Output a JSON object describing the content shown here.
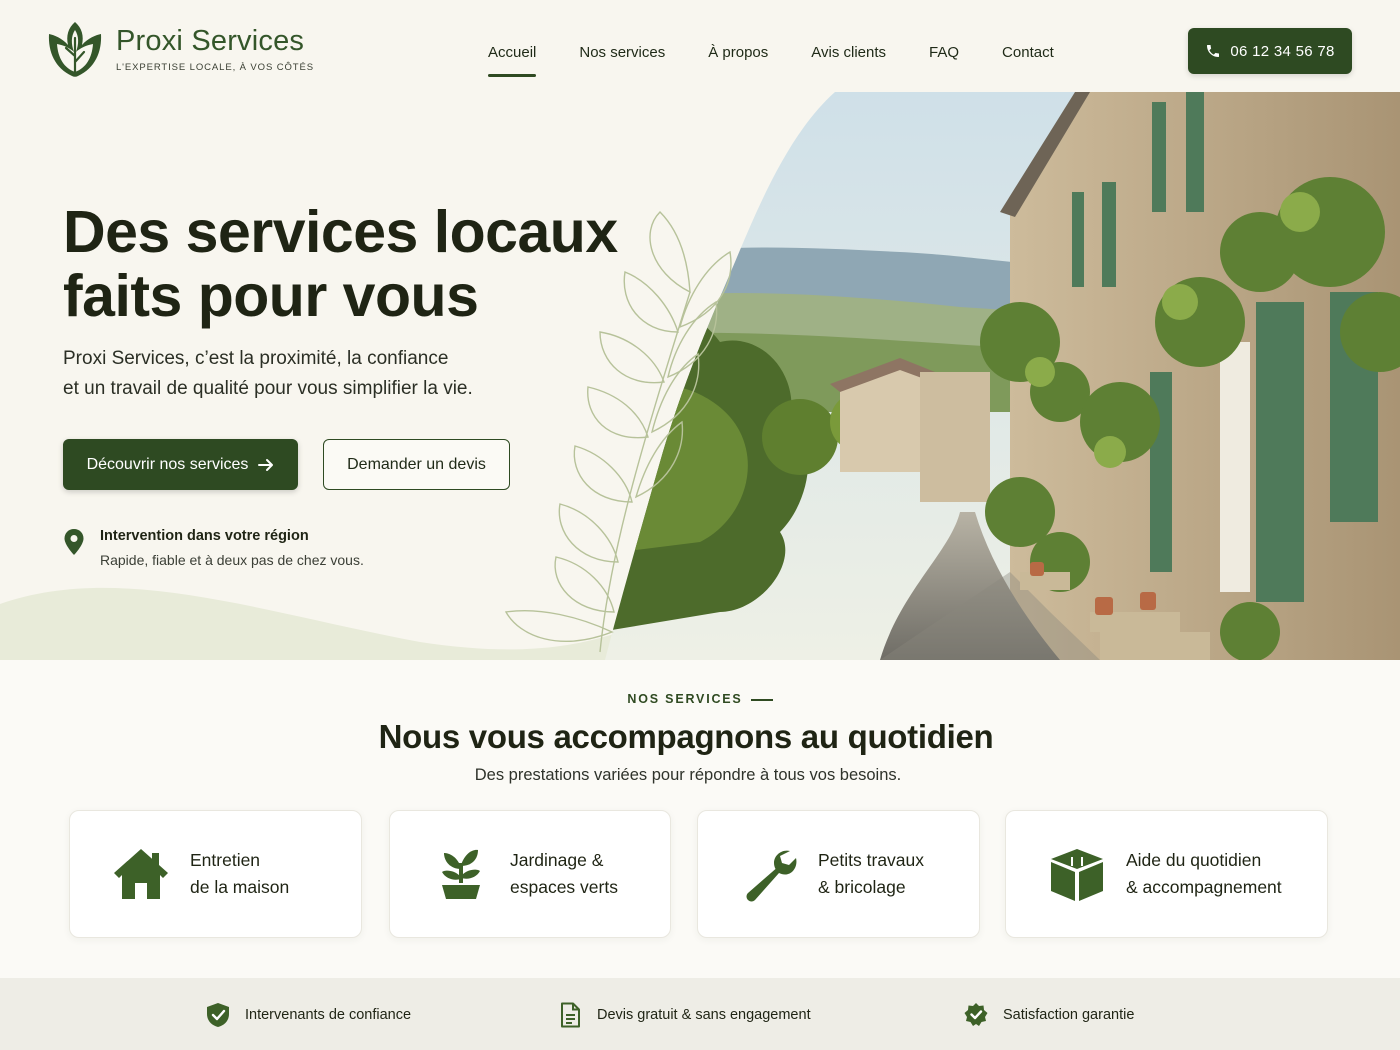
{
  "brand": {
    "name": "Proxi Services",
    "tagline": "L'EXPERTISE LOCALE, À VOS CÔTÉS"
  },
  "nav": [
    {
      "label": "Accueil",
      "active": true
    },
    {
      "label": "Nos services",
      "active": false
    },
    {
      "label": "À propos",
      "active": false
    },
    {
      "label": "Avis clients",
      "active": false
    },
    {
      "label": "FAQ",
      "active": false
    },
    {
      "label": "Contact",
      "active": false
    }
  ],
  "phone": {
    "label": "06 12 34 56 78",
    "icon": "phone-icon"
  },
  "hero": {
    "title_line1": "Des services locaux",
    "title_line2": "faits pour vous",
    "text_line1": "Proxi Services, c’est la proximité, la confiance",
    "text_line2": "et un travail de qualité pour vous simplifier la vie.",
    "primary_cta": "Découvrir nos services",
    "secondary_cta": "Demander un devis",
    "region_title": "Intervention dans votre région",
    "region_sub": "Rapide, fiable et à deux pas de chez vous."
  },
  "services": {
    "eyebrow": "NOS SERVICES",
    "title": "Nous vous accompagnons au quotidien",
    "subtitle": "Des prestations variées pour répondre à tous vos besoins.",
    "cards": [
      {
        "label": "Entretien\nde la maison",
        "icon": "house-icon"
      },
      {
        "label": "Jardinage &\nespaces verts",
        "icon": "plant-icon"
      },
      {
        "label": "Petits travaux\n& bricolage",
        "icon": "wrench-icon"
      },
      {
        "label": "Aide du quotidien\n& accompagnement",
        "icon": "box-icon"
      }
    ]
  },
  "trust": [
    {
      "label": "Intervenants de confiance",
      "icon": "shield-check-icon"
    },
    {
      "label": "Devis gratuit & sans engagement",
      "icon": "document-icon"
    },
    {
      "label": "Satisfaction garantie",
      "icon": "badge-check-icon"
    }
  ],
  "colors": {
    "primary": "#2e4a22",
    "background": "#f8f6ef",
    "text": "#1f2414"
  }
}
